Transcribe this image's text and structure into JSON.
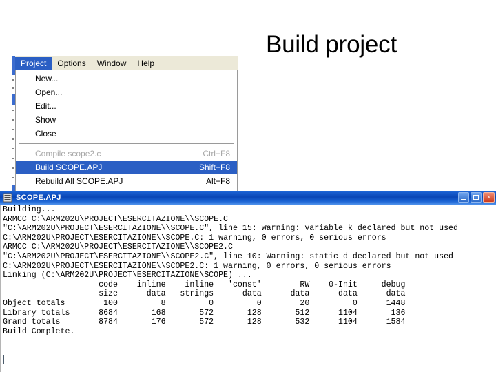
{
  "slide": {
    "title": "Build project"
  },
  "menu_window": {
    "menubar": [
      {
        "label": "Project",
        "active": true
      },
      {
        "label": "Options",
        "active": false
      },
      {
        "label": "Window",
        "active": false
      },
      {
        "label": "Help",
        "active": false
      }
    ],
    "dropdown_items": [
      {
        "label": "New...",
        "accel": "",
        "state": "normal"
      },
      {
        "label": "Open...",
        "accel": "",
        "state": "normal"
      },
      {
        "label": "Edit...",
        "accel": "",
        "state": "normal"
      },
      {
        "label": "Show",
        "accel": "",
        "state": "normal"
      },
      {
        "label": "Close",
        "accel": "",
        "state": "normal"
      },
      {
        "label": "Compile scope2.c",
        "accel": "Ctrl+F8",
        "state": "disabled"
      },
      {
        "label": "Build SCOPE.APJ",
        "accel": "Shift+F8",
        "state": "selected"
      },
      {
        "label": "Rebuild All SCOPE.APJ",
        "accel": "Alt+F8",
        "state": "normal"
      }
    ]
  },
  "console_window": {
    "title": "SCOPE.APJ",
    "title_icon": "application-window-icon",
    "buttons": {
      "minimize": "minimize-button",
      "maximize": "maximize-button",
      "close": "close-button",
      "close_glyph": "×"
    },
    "output": "Building...\nARMCC C:\\ARM202U\\PROJECT\\ESERCITAZIONE\\\\SCOPE.C\n\"C:\\ARM202U\\PROJECT\\ESERCITAZIONE\\\\SCOPE.C\", line 15: Warning: variable k declared but not used\nC:\\ARM202U\\PROJECT\\ESERCITAZIONE\\\\SCOPE.C: 1 warning, 0 errors, 0 serious errors\nARMCC C:\\ARM202U\\PROJECT\\ESERCITAZIONE\\\\SCOPE2.C\n\"C:\\ARM202U\\PROJECT\\ESERCITAZIONE\\\\SCOPE2.C\", line 10: Warning: static d declared but not used\nC:\\ARM202U\\PROJECT\\ESERCITAZIONE\\\\SCOPE2.C: 1 warning, 0 errors, 0 serious errors\nLinking (C:\\ARM202U\\PROJECT\\ESERCITAZIONE\\SCOPE) ...\n                    code    inline    inline   'const'        RW    0-Init     debug\n                    size      data   strings      data      data      data      data\nObject totals        100         8         0         0        20         0      1448\nLibrary totals      8684       168       572       128       512      1104       136\nGrand totals        8784       176       572       128       532      1104      1584\nBuild Complete.",
    "build_table": {
      "columns": [
        "",
        "code size",
        "inline data",
        "inline strings",
        "'const' data",
        "RW data",
        "0-Init data",
        "debug data"
      ],
      "rows": [
        {
          "label": "Object totals",
          "values": [
            100,
            8,
            0,
            0,
            20,
            0,
            1448
          ]
        },
        {
          "label": "Library totals",
          "values": [
            8684,
            168,
            572,
            128,
            512,
            1104,
            136
          ]
        },
        {
          "label": "Grand totals",
          "values": [
            8784,
            176,
            572,
            128,
            532,
            1104,
            1584
          ]
        }
      ]
    },
    "status_line": "Build Complete."
  },
  "colors": {
    "menu_highlight": "#2b5fc4",
    "titlebar_blue": "#0a46b6",
    "close_red": "#cc3b1d",
    "menubar_face": "#ece9d8",
    "disabled_text": "#a8a8a8"
  }
}
